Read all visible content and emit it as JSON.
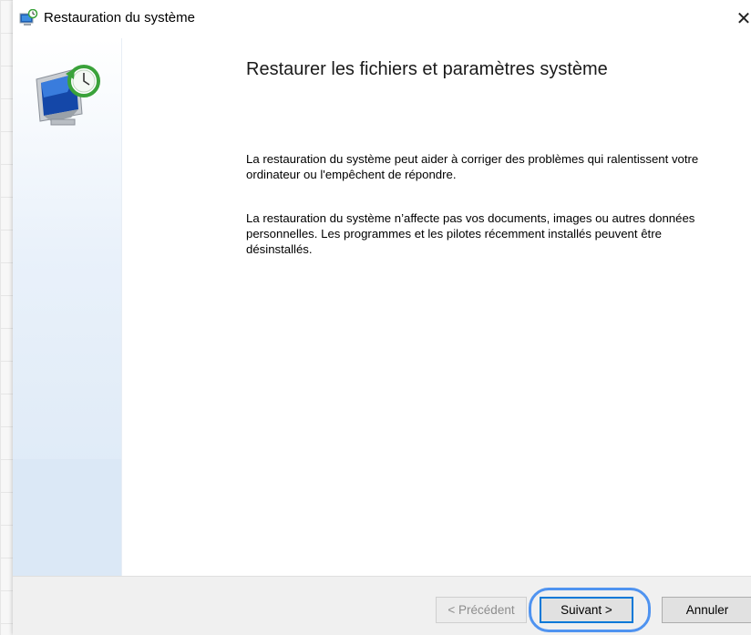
{
  "window": {
    "title": "Restauration du système",
    "icon": "system-restore-icon",
    "close_glyph": "✕"
  },
  "main": {
    "heading": "Restaurer les fichiers et paramètres système",
    "paragraph1": "La restauration du système peut aider à corriger des problèmes qui ralentissent votre ordinateur ou l'empêchent de répondre.",
    "paragraph2": "La restauration du système n’affecte pas vos documents, images ou autres données personnelles. Les programmes et les pilotes récemment installés peuvent être désinstallés."
  },
  "footer": {
    "prev_label": "< Précédent",
    "prev_enabled": false,
    "next_label": "Suivant >",
    "cancel_label": "Annuler",
    "highlighted_button": "next"
  },
  "colors": {
    "accent": "#0078d7",
    "highlight_ring": "#4f93f0",
    "sidebar": "#dbe8f6",
    "footer": "#f0f0f0"
  }
}
